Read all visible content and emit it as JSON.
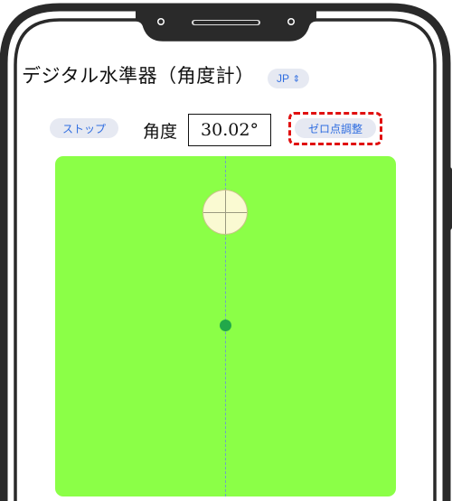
{
  "app": {
    "title": "デジタル水準器（角度計）",
    "language": {
      "selected": "JP"
    }
  },
  "controls": {
    "stop_label": "ストップ",
    "angle_label": "角度",
    "angle_value": "30.02°",
    "zero_adjust_label": "ゼロ点調整"
  },
  "icons": {
    "language_chevron": "chevron-up-down-icon",
    "bubble": "crosshair-icon"
  },
  "colors": {
    "panel_background": "#8bff47",
    "bubble_fill": "#fafad2",
    "center_dot": "#22a84a",
    "accent": "#2f6de0",
    "highlight": "#e01010"
  }
}
